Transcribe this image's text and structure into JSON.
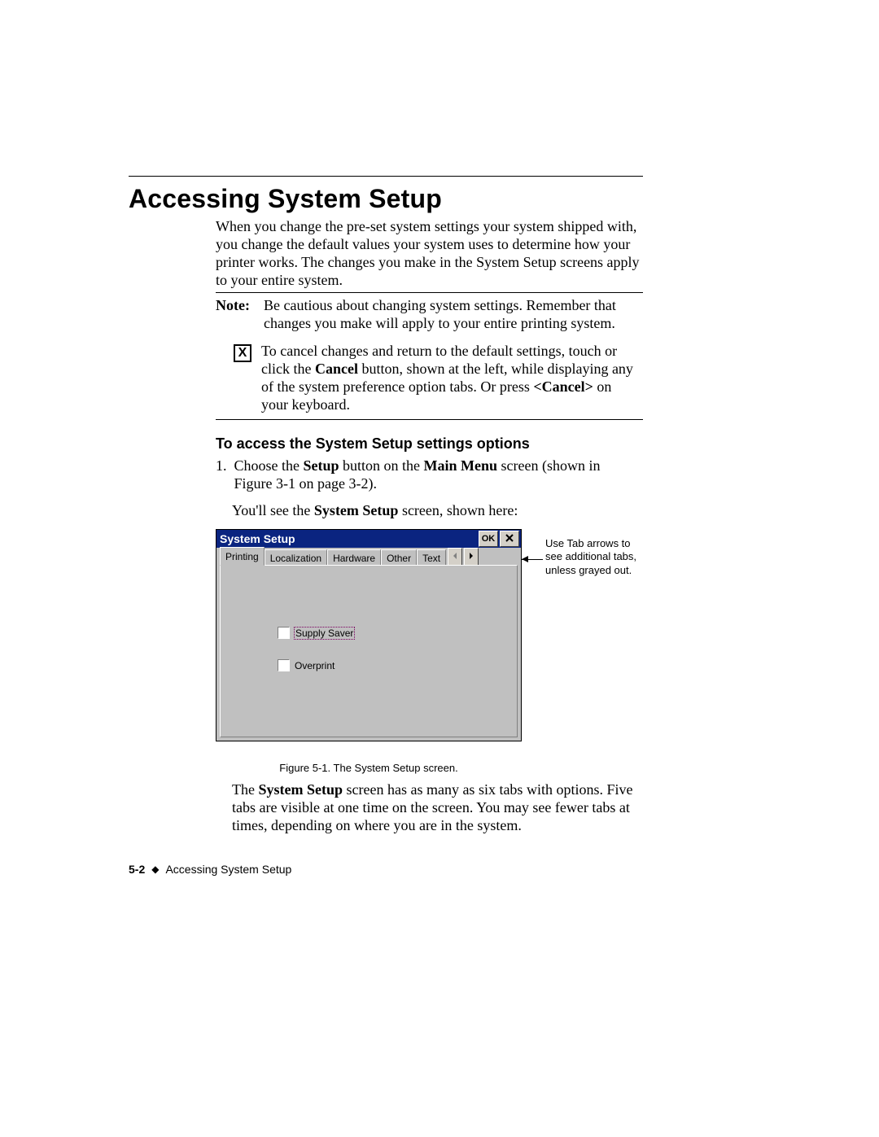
{
  "heading": "Accessing System Setup",
  "intro": "When you change the pre-set system settings your system shipped with, you change the default values your system uses to determine how your printer works. The changes you make in the System Setup screens apply to your entire system.",
  "note_label": "Note:",
  "note_text": "Be cautious about changing system settings. Remember that changes you make will apply to your entire printing system.",
  "cancel_icon_glyph": "X",
  "cancel_text_pre": "To cancel changes and return to the default settings, touch or click the ",
  "cancel_bold1": "Cancel",
  "cancel_text_mid": " button, shown at the left, while displaying any of the system preference option tabs. Or press ",
  "cancel_bold2": "<Cancel>",
  "cancel_text_post": " on your keyboard.",
  "subhead": "To access the System Setup settings options",
  "step1_num": "1.",
  "step1_pre": "Choose the ",
  "step1_b1": "Setup",
  "step1_mid1": " button on the ",
  "step1_b2": "Main Menu",
  "step1_post": " screen (shown in Figure 3-1 on page 3-2).",
  "step1b_pre": "You'll see the ",
  "step1b_b": "System Setup",
  "step1b_post": " screen, shown here:",
  "dialog": {
    "title": "System Setup",
    "ok": "OK",
    "close": "×",
    "tabs": [
      "Printing",
      "Localization",
      "Hardware",
      "Other",
      "Text"
    ],
    "checkbox1": "Supply Saver",
    "checkbox2": "Overprint"
  },
  "annotation": "Use Tab arrows to see additional tabs, unless grayed out.",
  "caption": "Figure 5-1. The System Setup screen.",
  "after_pre": "The ",
  "after_b": "System Setup",
  "after_post": " screen has as many as six tabs with options. Five tabs are visible at one time on the screen. You may see fewer tabs at times, depending on where you are in the system.",
  "footer_page": "5-2",
  "footer_sep": "◆",
  "footer_text": "Accessing System Setup"
}
